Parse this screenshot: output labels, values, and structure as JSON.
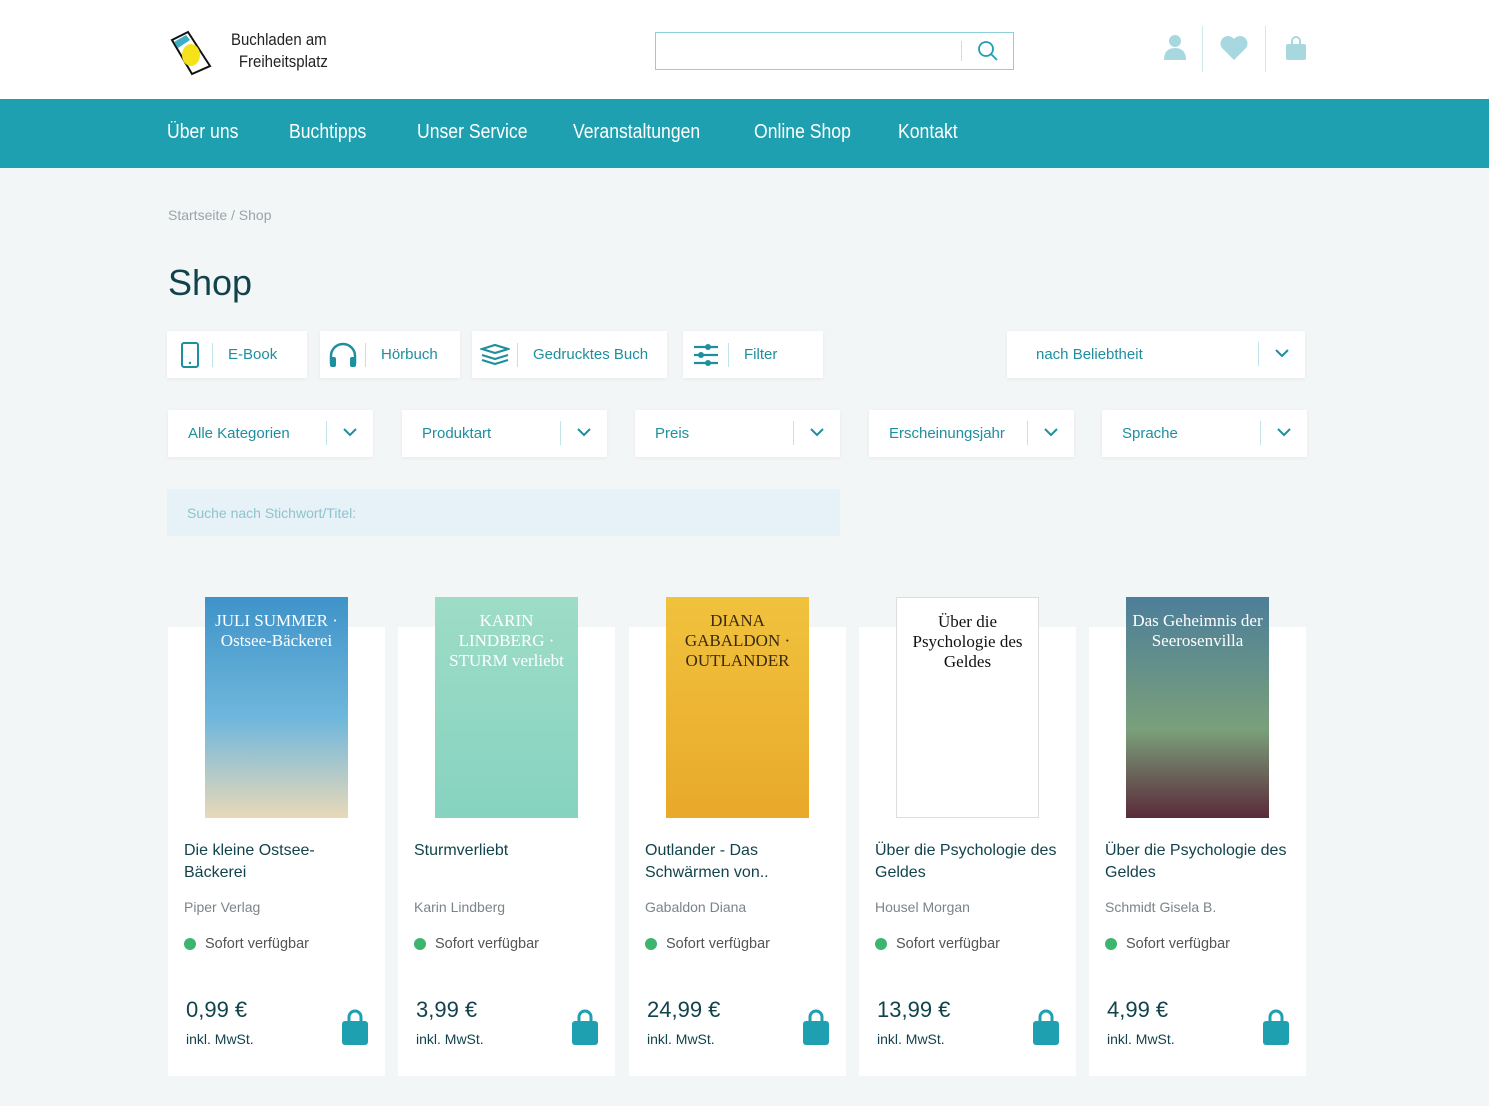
{
  "brand": {
    "line1": "Buchladen am",
    "line2": "Freiheitsplatz"
  },
  "search": {
    "placeholder": ""
  },
  "header_icons": [
    "user-icon",
    "heart-icon",
    "bag-icon"
  ],
  "nav": [
    "Über uns",
    "Buchtipps",
    "Unser Service",
    "Veranstaltungen",
    "Online Shop",
    "Kontakt"
  ],
  "breadcrumb": "Startseite / Shop",
  "title": "Shop",
  "types": [
    {
      "label": "E-Book",
      "icon": "tablet-icon"
    },
    {
      "label": "Hörbuch",
      "icon": "headphones-icon"
    },
    {
      "label": "Gedrucktes Buch",
      "icon": "books-icon"
    },
    {
      "label": "Filter",
      "icon": "sliders-icon"
    }
  ],
  "sort": "nach Beliebtheit",
  "filters": [
    "Alle Kategorien",
    "Produktart",
    "Preis",
    "Erscheinungsjahr",
    "Sprache"
  ],
  "keyword_placeholder": "Suche nach Stichwort/Titel:",
  "colors": {
    "accent": "#1ea0b0",
    "dark": "#12434c",
    "available": "#3db56e"
  },
  "products": [
    {
      "cover": "JULI SUMMER · Ostsee-Bäckerei",
      "title": "Die kleine Ostsee-Bäckerei",
      "author": "Piper Verlag",
      "status": "Sofort verfügbar",
      "price": "0,99 €",
      "vat": "inkl. MwSt."
    },
    {
      "cover": "KARIN LINDBERG · STURM verliebt",
      "title": "Sturmverliebt",
      "author": "Karin Lindberg",
      "status": "Sofort verfügbar",
      "price": "3,99 €",
      "vat": "inkl. MwSt."
    },
    {
      "cover": "DIANA GABALDON · OUTLANDER",
      "title": "Outlander - Das Schwärmen von..",
      "author": "Gabaldon Diana",
      "status": "Sofort verfügbar",
      "price": "24,99 €",
      "vat": "inkl. MwSt."
    },
    {
      "cover": "Über die Psychologie des Geldes",
      "title": "Über die Psychologie des Geldes",
      "author": "Housel Morgan",
      "status": "Sofort verfügbar",
      "price": "13,99 €",
      "vat": "inkl. MwSt."
    },
    {
      "cover": "Das Geheimnis der Seerosenvilla",
      "title": "Über die Psychologie des Geldes",
      "author": "Schmidt Gisela B.",
      "status": "Sofort verfügbar",
      "price": "4,99 €",
      "vat": "inkl. MwSt."
    }
  ]
}
